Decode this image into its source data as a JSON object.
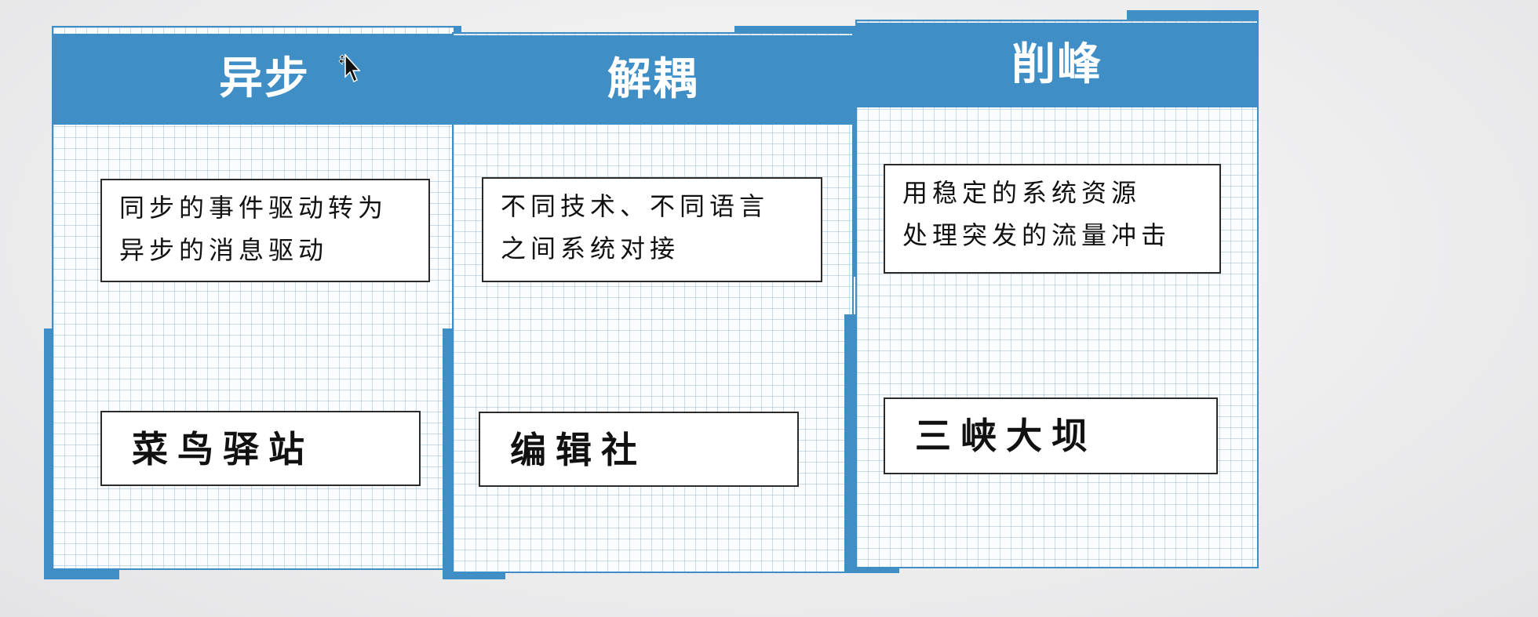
{
  "cards": [
    {
      "title": "异步",
      "description": "同步的事件驱动转为\n异步的消息驱动",
      "example": "菜鸟驿站"
    },
    {
      "title": "解耦",
      "description": "不同技术、不同语言\n之间系统对接",
      "example": "编辑社"
    },
    {
      "title": "削峰",
      "description": "用稳定的系统资源\n处理突发的流量冲击",
      "example": "三峡大坝"
    }
  ],
  "theme": {
    "accent": "#3f8fc6",
    "grid": "#a0bed6",
    "text": "#111111",
    "header_text": "#ffffff"
  },
  "icons": {
    "cursor": "move-cursor-icon"
  }
}
